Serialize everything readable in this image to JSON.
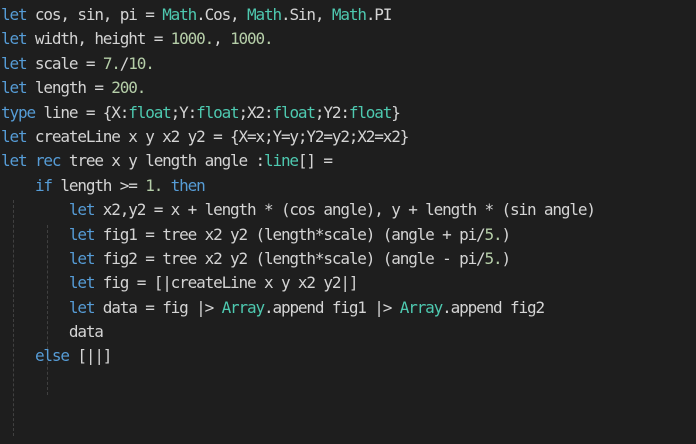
{
  "editor": {
    "language": "fsharp",
    "theme_colors": {
      "background": "#1e1e1e",
      "keyword": "#569cd6",
      "identifier": "#d4d4d4",
      "number": "#b5cea8",
      "type": "#4ec9b0",
      "indent_guide": "#404040"
    },
    "lines": [
      [
        {
          "t": "kw",
          "v": "let"
        },
        {
          "t": "id",
          "v": " cos, sin, pi = "
        },
        {
          "t": "mod",
          "v": "Math"
        },
        {
          "t": "id",
          "v": ".Cos, "
        },
        {
          "t": "mod",
          "v": "Math"
        },
        {
          "t": "id",
          "v": ".Sin, "
        },
        {
          "t": "mod",
          "v": "Math"
        },
        {
          "t": "id",
          "v": ".PI"
        }
      ],
      [
        {
          "t": "kw",
          "v": "let"
        },
        {
          "t": "id",
          "v": " width, height = "
        },
        {
          "t": "num",
          "v": "1000."
        },
        {
          "t": "id",
          "v": ", "
        },
        {
          "t": "num",
          "v": "1000."
        }
      ],
      [
        {
          "t": "kw",
          "v": "let"
        },
        {
          "t": "id",
          "v": " scale = "
        },
        {
          "t": "num",
          "v": "7."
        },
        {
          "t": "id",
          "v": "/"
        },
        {
          "t": "num",
          "v": "10."
        }
      ],
      [
        {
          "t": "kw",
          "v": "let"
        },
        {
          "t": "id",
          "v": " length = "
        },
        {
          "t": "num",
          "v": "200."
        }
      ],
      [
        {
          "t": "kw",
          "v": "type"
        },
        {
          "t": "id",
          "v": " line = {X:"
        },
        {
          "t": "type",
          "v": "float"
        },
        {
          "t": "id",
          "v": ";Y:"
        },
        {
          "t": "type",
          "v": "float"
        },
        {
          "t": "id",
          "v": ";X2:"
        },
        {
          "t": "type",
          "v": "float"
        },
        {
          "t": "id",
          "v": ";Y2:"
        },
        {
          "t": "type",
          "v": "float"
        },
        {
          "t": "id",
          "v": "}"
        }
      ],
      [
        {
          "t": "kw",
          "v": "let"
        },
        {
          "t": "id",
          "v": " createLine x y x2 y2 = {X=x;Y=y;Y2=y2;X2=x2}"
        }
      ],
      [
        {
          "t": "kw",
          "v": "let"
        },
        {
          "t": "id",
          "v": " "
        },
        {
          "t": "kw",
          "v": "rec"
        },
        {
          "t": "id",
          "v": " tree x y length angle :"
        },
        {
          "t": "type",
          "v": "line"
        },
        {
          "t": "id",
          "v": "[] ="
        }
      ],
      [
        {
          "t": "id",
          "v": "    "
        },
        {
          "t": "kw",
          "v": "if"
        },
        {
          "t": "id",
          "v": " length >= "
        },
        {
          "t": "num",
          "v": "1."
        },
        {
          "t": "id",
          "v": " "
        },
        {
          "t": "kw",
          "v": "then"
        }
      ],
      [
        {
          "t": "id",
          "v": "        "
        },
        {
          "t": "kw",
          "v": "let"
        },
        {
          "t": "id",
          "v": " x2,y2 = x + length * (cos angle), y + length * (sin angle)"
        }
      ],
      [
        {
          "t": "id",
          "v": "        "
        },
        {
          "t": "kw",
          "v": "let"
        },
        {
          "t": "id",
          "v": " fig1 = tree x2 y2 (length*scale) (angle + pi/"
        },
        {
          "t": "num",
          "v": "5."
        },
        {
          "t": "id",
          "v": ")"
        }
      ],
      [
        {
          "t": "id",
          "v": "        "
        },
        {
          "t": "kw",
          "v": "let"
        },
        {
          "t": "id",
          "v": " fig2 = tree x2 y2 (length*scale) (angle - pi/"
        },
        {
          "t": "num",
          "v": "5."
        },
        {
          "t": "id",
          "v": ")"
        }
      ],
      [
        {
          "t": "id",
          "v": "        "
        },
        {
          "t": "kw",
          "v": "let"
        },
        {
          "t": "id",
          "v": " fig = [|createLine x y x2 y2|]"
        }
      ],
      [
        {
          "t": "id",
          "v": "        "
        },
        {
          "t": "kw",
          "v": "let"
        },
        {
          "t": "id",
          "v": " data = fig |> "
        },
        {
          "t": "mod",
          "v": "Array"
        },
        {
          "t": "id",
          "v": ".append fig1 |> "
        },
        {
          "t": "mod",
          "v": "Array"
        },
        {
          "t": "id",
          "v": ".append fig2"
        }
      ],
      [
        {
          "t": "id",
          "v": "        data"
        }
      ],
      [
        {
          "t": "id",
          "v": "    "
        },
        {
          "t": "kw",
          "v": "else"
        },
        {
          "t": "id",
          "v": " [||]"
        }
      ]
    ]
  }
}
